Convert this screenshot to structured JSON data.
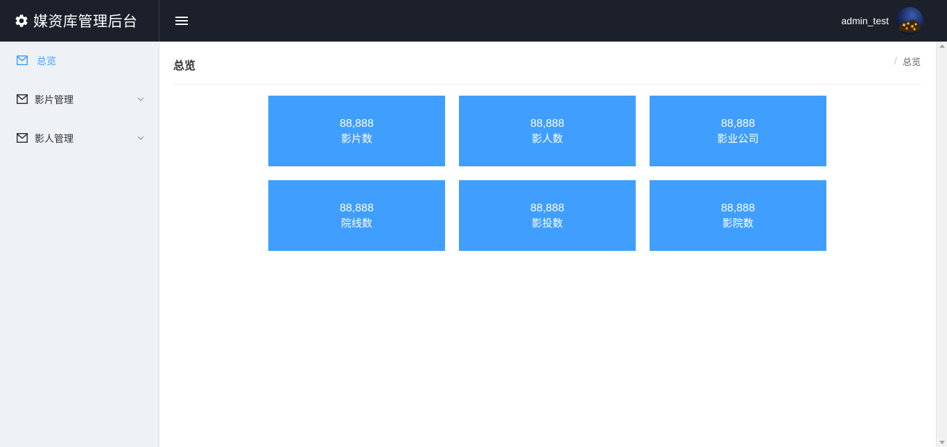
{
  "header": {
    "title": "媒资库管理后台",
    "username": "admin_test",
    "menu_toggle_icon": "hamburger-icon",
    "brand_icon": "gear-icon"
  },
  "sidebar": {
    "items": [
      {
        "label": "总览",
        "icon": "mail-icon",
        "active": true
      },
      {
        "label": "影片管理",
        "icon": "mail-icon",
        "has_submenu": true
      },
      {
        "label": "影人管理",
        "icon": "mail-icon",
        "has_submenu": true
      }
    ]
  },
  "main": {
    "page_title": "总览",
    "breadcrumb": {
      "separator": "/",
      "current": "总览"
    },
    "stats": [
      {
        "value": "88,888",
        "label": "影片数"
      },
      {
        "value": "88,888",
        "label": "影人数"
      },
      {
        "value": "88,888",
        "label": "影业公司"
      },
      {
        "value": "88,888",
        "label": "院线数"
      },
      {
        "value": "88,888",
        "label": "影投数"
      },
      {
        "value": "88,888",
        "label": "影院数"
      }
    ]
  },
  "colors": {
    "header_bg": "#1b202a",
    "sidebar_bg": "#eef1f6",
    "accent": "#409eff",
    "card_bg": "#409eff"
  }
}
